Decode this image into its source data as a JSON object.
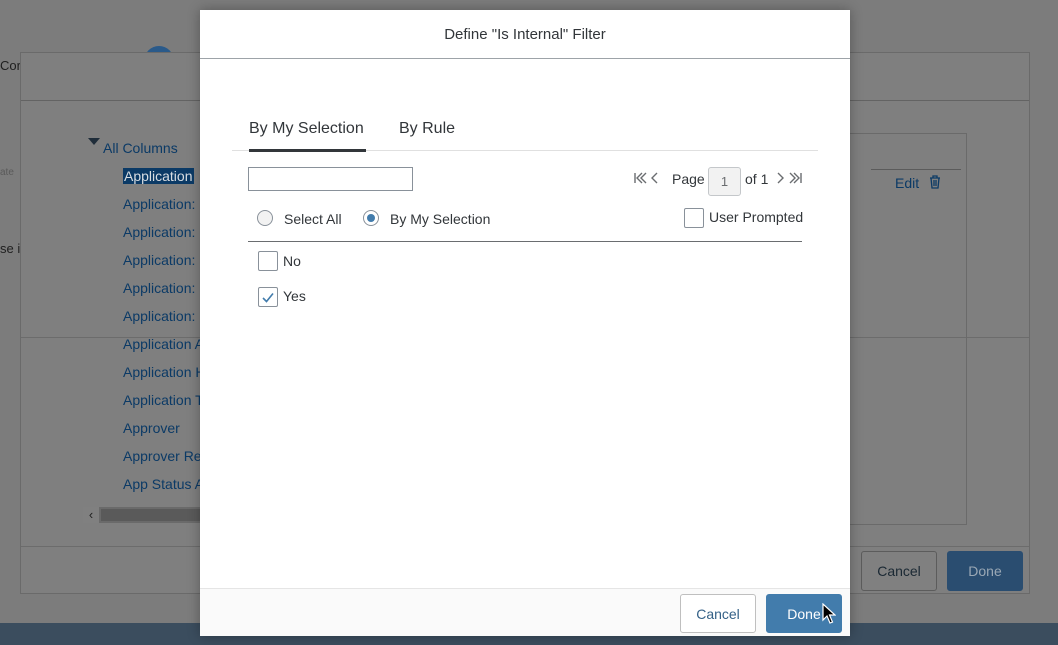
{
  "background": {
    "edge_texts": [
      "Cor",
      "ate",
      "se in"
    ],
    "tree": {
      "root_label": "All Columns",
      "items": [
        "Application",
        "Application: (",
        "Application: I",
        "Application: I",
        "Application: I",
        "Application: I",
        "Application A",
        "Application H",
        "Application T",
        "Approver",
        "Approver Re",
        "App Status A"
      ]
    },
    "edit_label": "Edit",
    "scroll_left_glyph": "‹",
    "cancel_label": "Cancel",
    "done_label": "Done"
  },
  "dialog": {
    "title": "Define \"Is Internal\" Filter",
    "tabs": [
      {
        "label": "By My Selection",
        "active": true
      },
      {
        "label": "By Rule",
        "active": false
      }
    ],
    "search": {
      "value": "",
      "placeholder": ""
    },
    "pager": {
      "page_label": "Page",
      "current_page": "1",
      "of_label": "of 1"
    },
    "select_mode": {
      "options": [
        {
          "label": "Select All",
          "selected": false
        },
        {
          "label": "By My Selection",
          "selected": true
        }
      ]
    },
    "user_prompted": {
      "label": "User Prompted",
      "checked": false
    },
    "values": [
      {
        "label": "No",
        "checked": false
      },
      {
        "label": "Yes",
        "checked": true
      }
    ],
    "footer": {
      "cancel_label": "Cancel",
      "done_label": "Done"
    },
    "colors": {
      "accent": "#427cac",
      "text": "#32363a",
      "link": "#346187"
    }
  }
}
